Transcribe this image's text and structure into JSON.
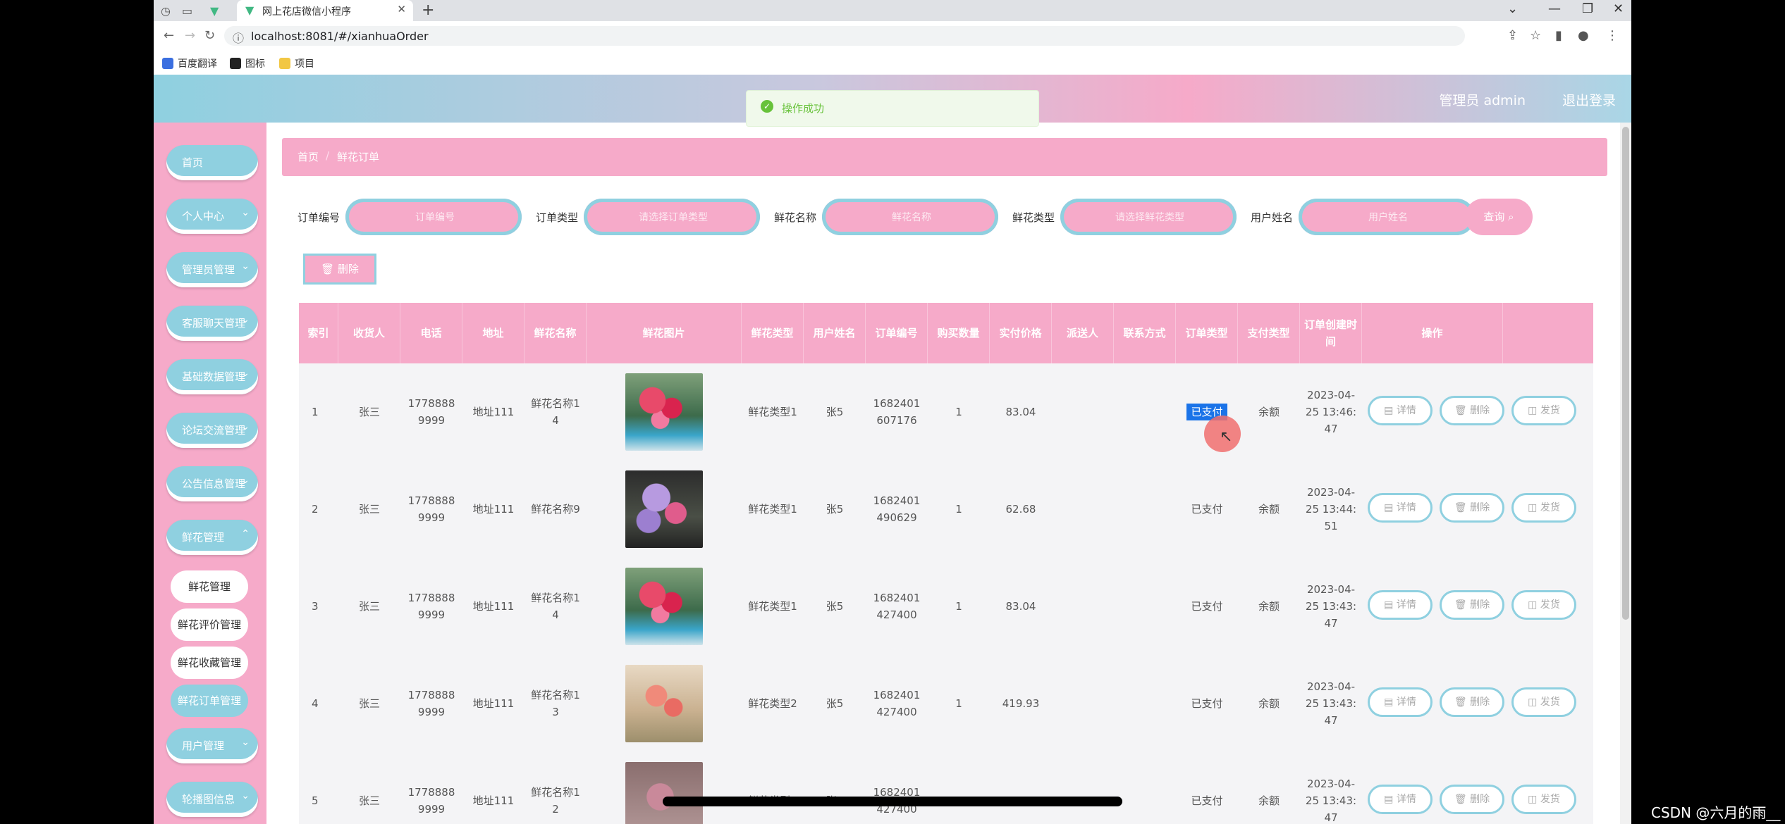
{
  "browser": {
    "tab_title": "网上花店微信小程序",
    "url": "localhost:8081/#/xianhuaOrder",
    "bookmarks": [
      "百度翻译",
      "图标",
      "项目"
    ]
  },
  "header": {
    "user": "管理员 admin",
    "logout": "退出登录"
  },
  "toast": {
    "message": "操作成功"
  },
  "sidebar": {
    "items": [
      {
        "label": "首页",
        "chev": ""
      },
      {
        "label": "个人中心",
        "chev": "⌄"
      },
      {
        "label": "管理员管理",
        "chev": "⌄"
      },
      {
        "label": "客服聊天管理",
        "chev": "⌄"
      },
      {
        "label": "基础数据管理",
        "chev": "⌄"
      },
      {
        "label": "论坛交流管理",
        "chev": "⌄"
      },
      {
        "label": "公告信息管理",
        "chev": "⌄"
      },
      {
        "label": "鲜花管理",
        "chev": "⌃"
      }
    ],
    "sub_items": [
      "鲜花管理",
      "鲜花评价管理",
      "鲜花收藏管理",
      "鲜花订单管理"
    ],
    "items_after": [
      {
        "label": "用户管理",
        "chev": "⌄"
      },
      {
        "label": "轮播图信息",
        "chev": "⌄"
      }
    ]
  },
  "breadcrumb": {
    "home": "首页",
    "sep": "/",
    "current": "鲜花订单"
  },
  "filters": {
    "order_no": {
      "label": "订单编号",
      "placeholder": "订单编号"
    },
    "order_type": {
      "label": "订单类型",
      "placeholder": "请选择订单类型"
    },
    "flower_name": {
      "label": "鲜花名称",
      "placeholder": "鲜花名称"
    },
    "flower_type": {
      "label": "鲜花类型",
      "placeholder": "请选择鲜花类型"
    },
    "user_name": {
      "label": "用户姓名",
      "placeholder": "用户姓名"
    },
    "query": "查询 ⌕"
  },
  "delete_button": "🗑 删除",
  "table": {
    "headers": [
      "索引",
      "收货人",
      "电话",
      "地址",
      "鲜花名称",
      "鲜花图片",
      "鲜花类型",
      "用户姓名",
      "订单编号",
      "购买数量",
      "实付价格",
      "派送人",
      "联系方式",
      "订单类型",
      "支付类型",
      "订单创建时间",
      "操作"
    ],
    "actions": [
      "▤ 详情",
      "🗑 删除",
      "◫ 发货"
    ],
    "rows": [
      {
        "idx": "1",
        "receiver": "张三",
        "phone": "17788889999",
        "addr": "地址111",
        "fname": "鲜花名称14",
        "ftype": "鲜花类型1",
        "uname": "张5",
        "order_no": "1682401607176",
        "qty": "1",
        "price": "83.04",
        "courier": "",
        "contact": "",
        "otype": "已支付",
        "ptype": "余额",
        "time": "2023-04-25 13:46:47",
        "img": "pink"
      },
      {
        "idx": "2",
        "receiver": "张三",
        "phone": "17788889999",
        "addr": "地址111",
        "fname": "鲜花名称9",
        "ftype": "鲜花类型1",
        "uname": "张5",
        "order_no": "1682401490629",
        "qty": "1",
        "price": "62.68",
        "courier": "",
        "contact": "",
        "otype": "已支付",
        "ptype": "余额",
        "time": "2023-04-25 13:44:51",
        "img": "purple"
      },
      {
        "idx": "3",
        "receiver": "张三",
        "phone": "17788889999",
        "addr": "地址111",
        "fname": "鲜花名称14",
        "ftype": "鲜花类型1",
        "uname": "张5",
        "order_no": "1682401427400",
        "qty": "1",
        "price": "83.04",
        "courier": "",
        "contact": "",
        "otype": "已支付",
        "ptype": "余额",
        "time": "2023-04-25 13:43:47",
        "img": "pink"
      },
      {
        "idx": "4",
        "receiver": "张三",
        "phone": "17788889999",
        "addr": "地址111",
        "fname": "鲜花名称13",
        "ftype": "鲜花类型2",
        "uname": "张5",
        "order_no": "1682401427400",
        "qty": "1",
        "price": "419.93",
        "courier": "",
        "contact": "",
        "otype": "已支付",
        "ptype": "余额",
        "time": "2023-04-25 13:43:47",
        "img": "peach"
      },
      {
        "idx": "5",
        "receiver": "张三",
        "phone": "17788889999",
        "addr": "地址111",
        "fname": "鲜花名称12",
        "ftype": "鲜花类型4",
        "uname": "张5",
        "order_no": "1682401427400",
        "qty": "1",
        "price": "",
        "courier": "",
        "contact": "",
        "otype": "已支付",
        "ptype": "余额",
        "time": "2023-04-25 13:43:47",
        "img": "rose"
      }
    ]
  },
  "watermark": "CSDN @六月的雨__"
}
